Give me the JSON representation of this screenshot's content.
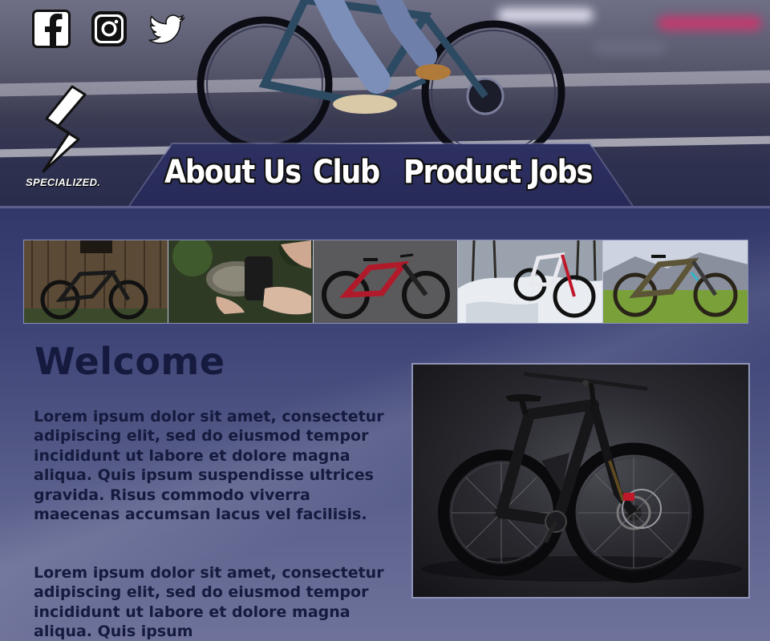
{
  "social": {
    "facebook_icon": "facebook-icon",
    "instagram_icon": "instagram-icon",
    "twitter_icon": "twitter-icon"
  },
  "brand": {
    "logo_icon": "specialized-s-logo",
    "name": "SPECIALIZED."
  },
  "nav": {
    "items": [
      {
        "label": "About Us"
      },
      {
        "label": "Club"
      },
      {
        "label": "Product"
      },
      {
        "label": "Jobs"
      }
    ]
  },
  "thumbnails": [
    {
      "icon": "mtb-barn-photo"
    },
    {
      "icon": "motor-hands-photo"
    },
    {
      "icon": "red-mtb-photo"
    },
    {
      "icon": "snow-bike-photo"
    },
    {
      "icon": "grass-mtb-photo"
    }
  ],
  "content": {
    "title": "Welcome",
    "paragraphs": [
      "Lorem ipsum dolor sit amet, consectetur adipiscing elit, sed do eiusmod tempor incididunt ut labore et dolore magna aliqua. Quis ipsum suspendisse ultrices gravida. Risus commodo viverra maecenas accumsan lacus vel facilisis.",
      "Lorem ipsum dolor sit amet, consectetur adipiscing elit, sed do eiusmod tempor incididunt ut labore et dolore magna aliqua. Quis ipsum"
    ],
    "feature_image_icon": "black-mtb-photo"
  },
  "colors": {
    "background": "#33386a",
    "nav_panel": "#2d3062",
    "text": "#151a3e",
    "accent_red": "#c0182b"
  }
}
